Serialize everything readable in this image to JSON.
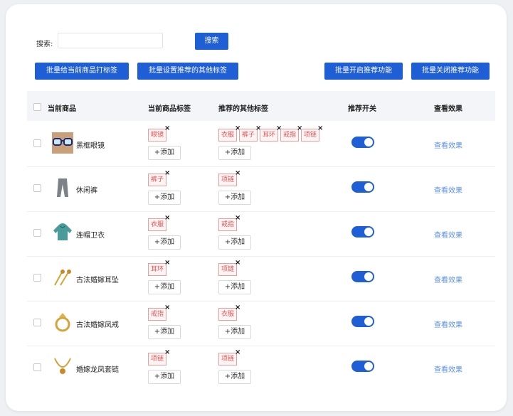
{
  "search": {
    "label": "搜索:",
    "placeholder": "",
    "button": "搜索"
  },
  "actions": {
    "tag_current": "批量给当前商品打标签",
    "set_recommended": "批量设置推荐的其他标签",
    "enable_recommend": "批量开启推荐功能",
    "disable_recommend": "批量关闭推荐功能"
  },
  "table": {
    "headers": {
      "product": "当前商品",
      "current_tags": "当前商品标签",
      "recommended_tags": "推荐的其他标签",
      "switch": "推荐开关",
      "view": "查看效果"
    },
    "add_label": "+添加",
    "view_label": "查看效果",
    "rows": [
      {
        "name": "黑框眼镜",
        "icon": "glasses-icon",
        "current_tags": [
          "眼镜"
        ],
        "recommended_tags": [
          "衣服",
          "裤子",
          "耳环",
          "戒指",
          "项链"
        ],
        "switch_on": true
      },
      {
        "name": "休闲裤",
        "icon": "pants-icon",
        "current_tags": [
          "裤子"
        ],
        "recommended_tags": [
          "项链"
        ],
        "switch_on": true
      },
      {
        "name": "连帽卫衣",
        "icon": "hoodie-icon",
        "current_tags": [
          "衣服"
        ],
        "recommended_tags": [
          "戒指"
        ],
        "switch_on": true
      },
      {
        "name": "古法婚嫁耳坠",
        "icon": "earring-icon",
        "current_tags": [
          "耳环"
        ],
        "recommended_tags": [
          "项链"
        ],
        "switch_on": true
      },
      {
        "name": "古法婚嫁凤戒",
        "icon": "ring-icon",
        "current_tags": [
          "戒指"
        ],
        "recommended_tags": [
          "衣服"
        ],
        "switch_on": true
      },
      {
        "name": "婚嫁龙凤套链",
        "icon": "necklace-icon",
        "current_tags": [
          "项链"
        ],
        "recommended_tags": [
          "项链"
        ],
        "switch_on": true
      }
    ]
  },
  "colors": {
    "primary": "#1f5fd6",
    "tag_border": "#e6a0a0",
    "tag_text": "#e05555",
    "link": "#5b8fe3"
  }
}
